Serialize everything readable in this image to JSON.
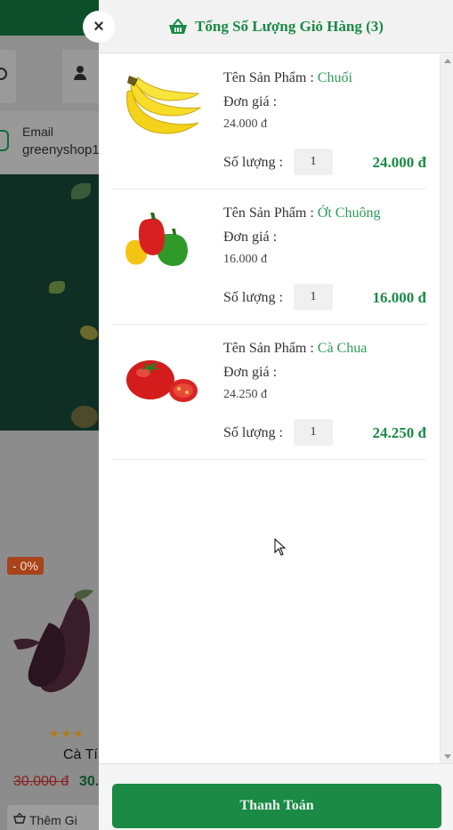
{
  "background_page": {
    "email_label": "Email",
    "email_value": "greenyshop1",
    "discount_badge": "- 0%",
    "rating_stars": "★★★",
    "product_name": "Cà Tí",
    "old_price": "30.000 đ",
    "new_price": "30.",
    "add_button_label": "Thêm Gi"
  },
  "cart": {
    "close_label": "×",
    "title": "Tổng Số Lượng Giỏ Hàng (3)",
    "name_label": "Tên Sản Phẩm :",
    "unit_price_label": "Đơn giá :",
    "quantity_label": "Số lượng :",
    "items": [
      {
        "name": "Chuối",
        "unit_price": "24.000 đ",
        "quantity": "1",
        "total": "24.000 đ",
        "image": "banana"
      },
      {
        "name": "Ớt Chuông",
        "unit_price": "16.000 đ",
        "quantity": "1",
        "total": "16.000 đ",
        "image": "bell-pepper"
      },
      {
        "name": "Cà Chua",
        "unit_price": "24.250 đ",
        "quantity": "1",
        "total": "24.250 đ",
        "image": "tomato"
      }
    ],
    "checkout_label": "Thanh Toán"
  },
  "colors": {
    "brand_green": "#1a8a45",
    "product_name_green": "#2e9b57"
  }
}
